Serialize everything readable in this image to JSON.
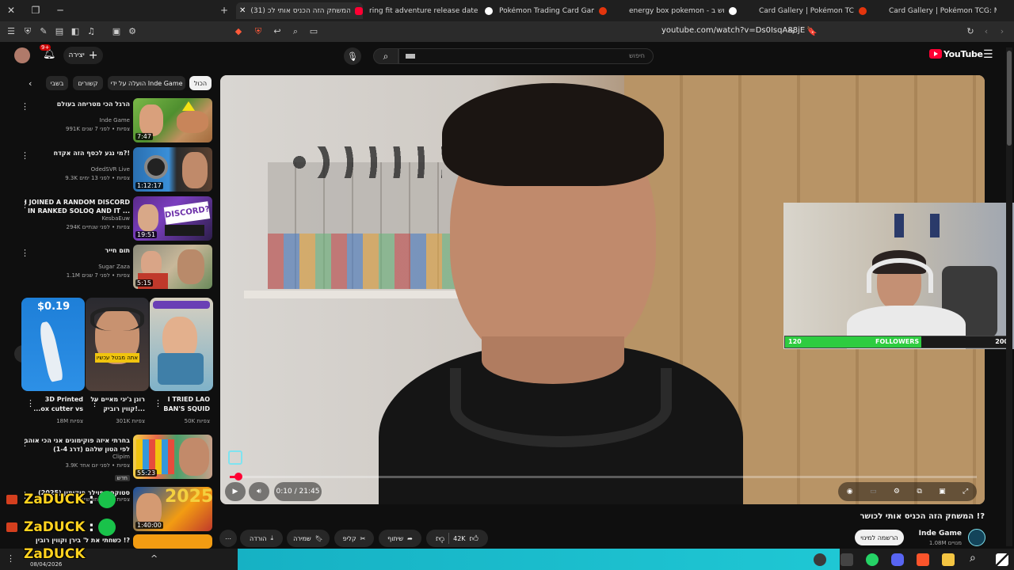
{
  "browser": {
    "tabs": [
      {
        "label": "(31) המשחק הזה הכניס אותי לכ",
        "active": true
      },
      {
        "label": "ring fit adventure release date - חיפוש ב"
      },
      {
        "label": "Pokémon Trading Card Game"
      },
      {
        "label": "energy box pokemon - חיפוש ב-Goo"
      },
      {
        "label": "Card Gallery | Pokémon TCG: Mega E"
      },
      {
        "label": "Card Gallery | Pokémon TCG: Mega E"
      }
    ],
    "url": "youtube.com/watch?v=Ds0IsqA88jE"
  },
  "yt": {
    "logo": "YouTube",
    "create_label": "יצירה",
    "notif_count": "9+",
    "search_placeholder": "חיפוש"
  },
  "chips": [
    "הכול",
    "הועלה על ידי Inde Game",
    "קשורים",
    "בשבי"
  ],
  "recs": [
    {
      "title": "הרגל הכי מטריחה בעולם",
      "channel": "Inde Game",
      "meta": "991K צפיות • לפני 7 שנים",
      "duration": "7:47"
    },
    {
      "title": "מי נגע לכסף הזה אקדח?!",
      "channel": "OdedSVR Live",
      "meta": "9.3K צפיות • לפני 13 ימים",
      "duration": "1:12:17"
    },
    {
      "title": "I JOINED A RANDOM DISCORD IN RANKED SOLOQ AND IT ...",
      "channel": "KesbaEuw",
      "meta": "294K צפיות • לפני שנתיים",
      "duration": "19:51"
    },
    {
      "title": "תום חייר",
      "channel": "Sugar Zaza",
      "meta": "1.1M צפיות • לפני 7 שנים",
      "duration": "5:15"
    }
  ],
  "shorts": [
    {
      "title": "I TRIED LAO BAN'S SQUID",
      "views": "50K צפיות"
    },
    {
      "title": "רונן ג'יגי מאיים על קווין רוביק!...",
      "views": "301K צפיות"
    },
    {
      "title": "3D Printed ...ox cutter vs",
      "views": "18M צפיות"
    }
  ],
  "shorts_price": "$0.19",
  "recs2": [
    {
      "title": "בחרתי איזה פוקימונים אני הכי אוהב לפי הטון שלהם (דרג 1-4)",
      "channel": "Clipim",
      "meta": "3.9K צפיות • לפני יום אחד",
      "badge": "חדש",
      "duration": "55:23"
    },
    {
      "title": "סטוקס ספוילר פוקימון (2025)",
      "channel": "Clipim",
      "meta": "צפיות • לפני חודשיים",
      "duration": "1:40:00"
    },
    {
      "title": "כשחתי את ל' בירן וקווין רובין !?",
      "channel": "",
      "meta": "",
      "duration": ""
    }
  ],
  "player": {
    "time": "0:10 / 21:45",
    "progress": 0.008
  },
  "overlay": {
    "followers_left": "120",
    "followers_label": "FOLLOWERS",
    "followers_right": "200",
    "followers_progress": 0.6
  },
  "video": {
    "title": "המשחק הזה הכניס אותי לכושר !?",
    "channel": "Inde Game",
    "subs": "1.08M מנויים",
    "subscribe_label": "הרשמה למינוי",
    "likes": "42K",
    "share_label": "שיתוף",
    "clip_label": "קליפ",
    "save_label": "שמירה",
    "download_label": "הורדה"
  },
  "stream": {
    "name": "ZaDUCK"
  },
  "taskbar": {
    "date": "08/04/2026"
  },
  "colors": {
    "yt_red": "#ff0033",
    "followers_green": "#2ecc40",
    "zaduck_yellow": "#ffd21f"
  }
}
